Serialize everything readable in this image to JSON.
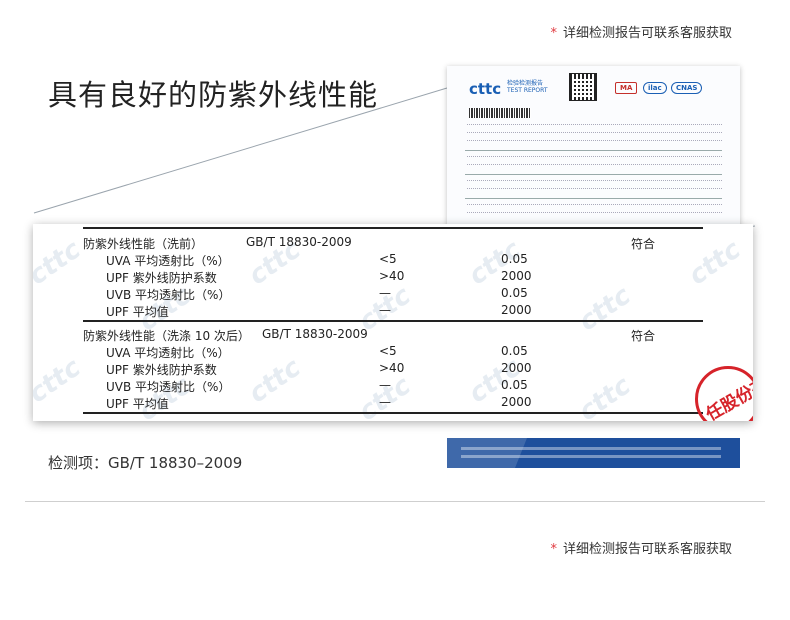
{
  "notes": {
    "star": "*",
    "text": "详细检测报告可联系客服获取"
  },
  "headline": "具有良好的防紫外线性能",
  "report": {
    "logo": "cttc",
    "logo_sub": "检验检测报告\nTEST REPORT",
    "marks": [
      "MA",
      "ilac",
      "CNAS"
    ]
  },
  "watermark": "cttc",
  "table": {
    "sections": [
      {
        "title": "防紫外线性能（洗前）",
        "standard": "GB/T 18830-2009",
        "result": "符合",
        "rows": [
          {
            "name": "UVA 平均透射比（%）",
            "req": "<5",
            "val": "0.05"
          },
          {
            "name": "UPF 紫外线防护系数",
            "req": ">40",
            "val": "2000"
          },
          {
            "name": "UVB 平均透射比（%）",
            "req": "—",
            "val": "0.05"
          },
          {
            "name": "UPF 平均值",
            "req": "—",
            "val": "2000"
          }
        ]
      },
      {
        "title": "防紫外线性能（洗涤 10 次后）",
        "standard": "GB/T 18830-2009",
        "result": "符合",
        "rows": [
          {
            "name": "UVA 平均透射比（%）",
            "req": "<5",
            "val": "0.05"
          },
          {
            "name": "UPF 紫外线防护系数",
            "req": ">40",
            "val": "2000"
          },
          {
            "name": "UVB 平均透射比（%）",
            "req": "—",
            "val": "0.05"
          },
          {
            "name": "UPF 平均值",
            "req": "—",
            "val": "2000"
          }
        ]
      }
    ]
  },
  "stamp": "任股份有",
  "test_item": "检测项：GB/T 18830–2009",
  "colors": {
    "accent_red": "#e0383e",
    "report_blue": "#1e4f9c",
    "stamp_red": "#d6232a"
  }
}
